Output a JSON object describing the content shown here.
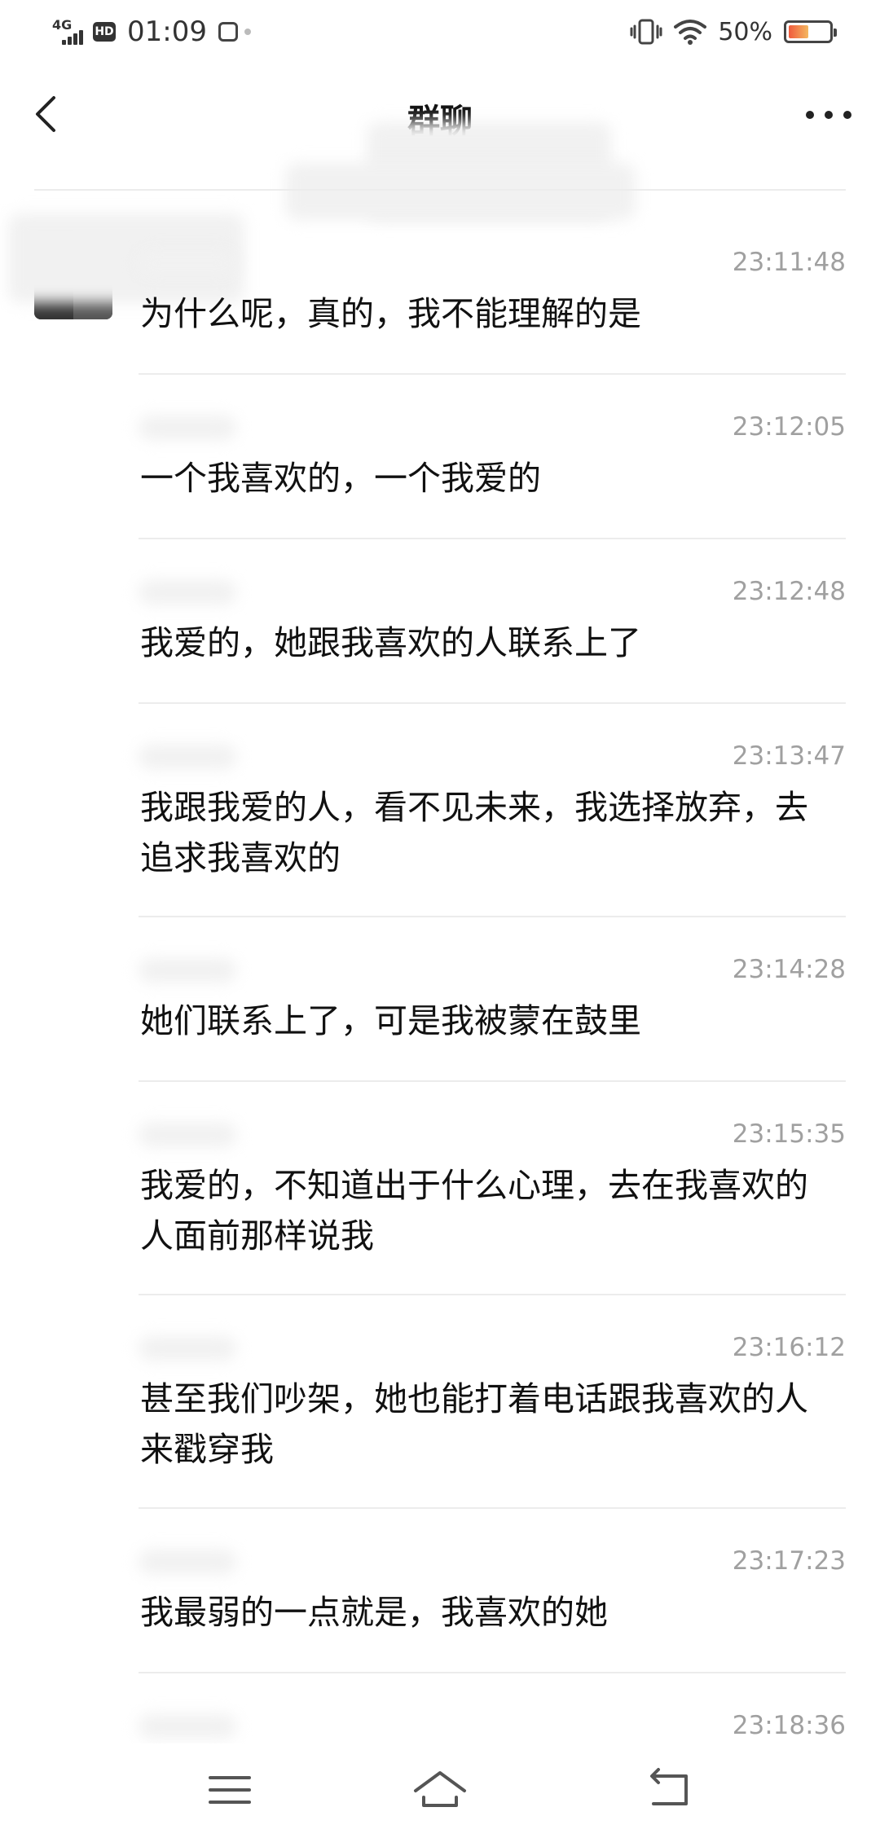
{
  "status_bar": {
    "network": "4G",
    "hd": "HD",
    "time": "01:09",
    "battery_text": "50%",
    "battery_level": 0.5
  },
  "title_bar": {
    "title": "群聊",
    "back_icon": "chevron-left-icon",
    "more_icon": "more-horizontal-icon"
  },
  "messages": [
    {
      "time": "23:11:48",
      "text": "为什么呢，真的，我不能理解的是"
    },
    {
      "time": "23:12:05",
      "text": "一个我喜欢的，一个我爱的"
    },
    {
      "time": "23:12:48",
      "text": "我爱的，她跟我喜欢的人联系上了"
    },
    {
      "time": "23:13:47",
      "text": "我跟我爱的人，看不见未来，我选择放弃，去追求我喜欢的"
    },
    {
      "time": "23:14:28",
      "text": "她们联系上了，可是我被蒙在鼓里"
    },
    {
      "time": "23:15:35",
      "text": "我爱的，不知道出于什么心理，去在我喜欢的人面前那样说我"
    },
    {
      "time": "23:16:12",
      "text": "甚至我们吵架，她也能打着电话跟我喜欢的人来戳穿我"
    },
    {
      "time": "23:17:23",
      "text": "我最弱的一点就是，我喜欢的她"
    },
    {
      "time": "23:18:36",
      "text": ""
    }
  ],
  "nav": {
    "menu_icon": "menu-icon",
    "home_icon": "home-icon",
    "back_icon": "back-icon"
  }
}
